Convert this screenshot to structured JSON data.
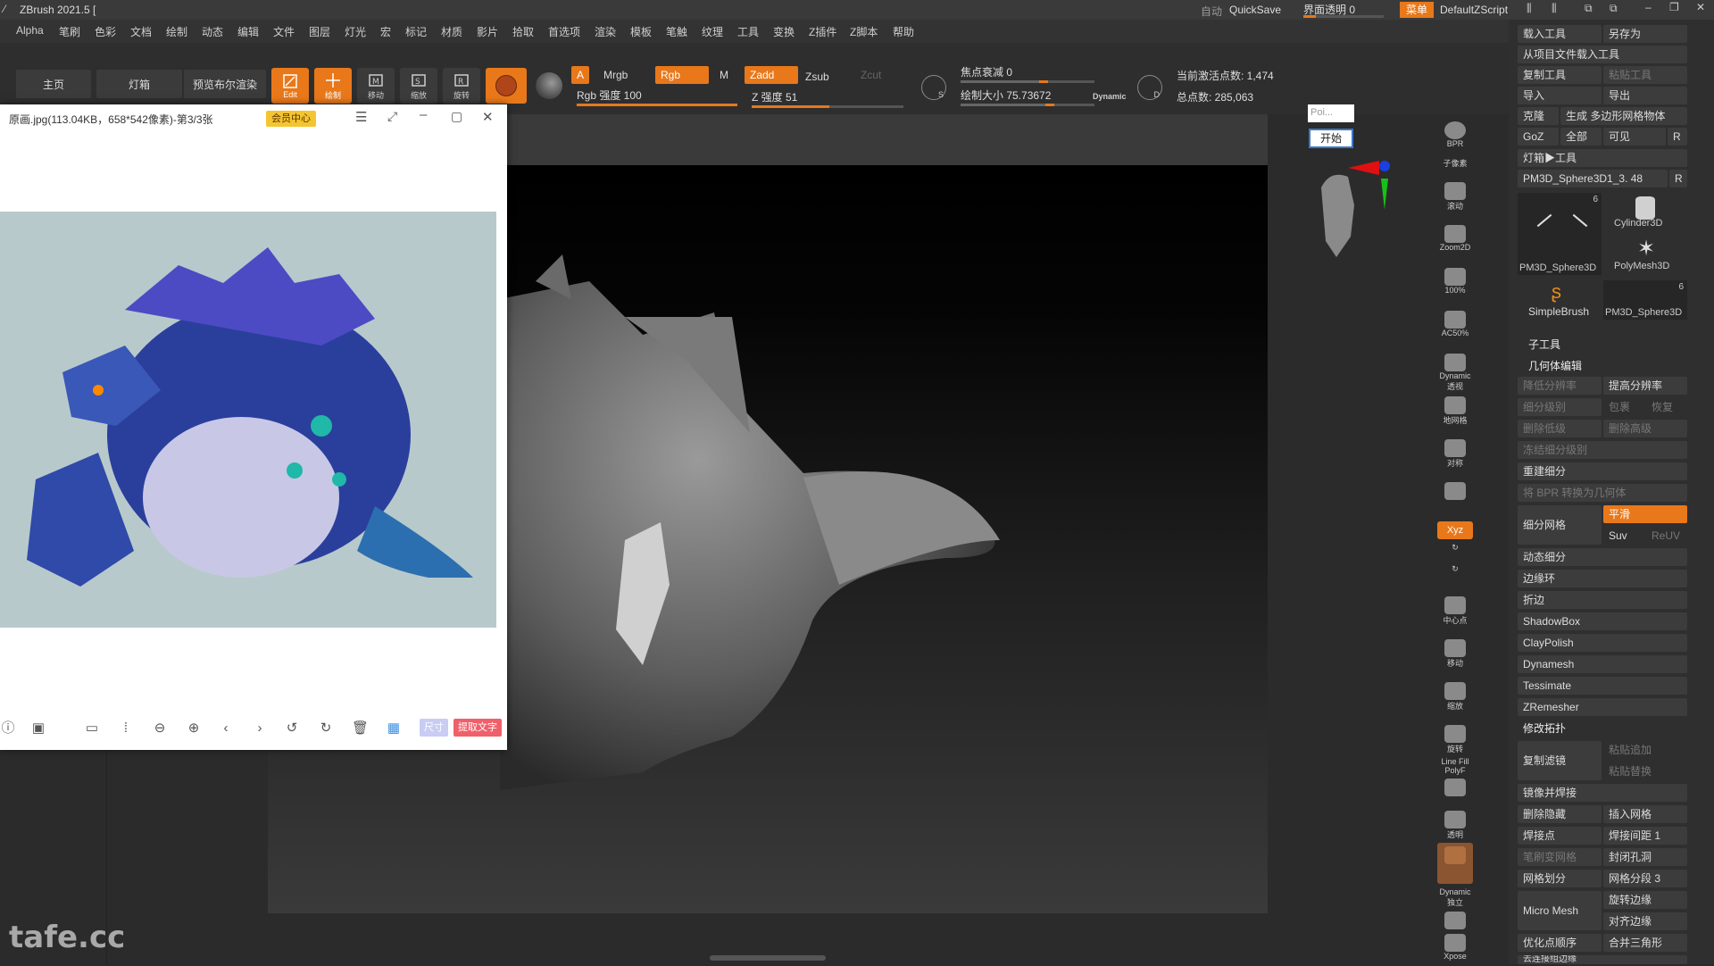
{
  "app": {
    "title": "ZBrush 2021.5 [",
    "auto": "自动",
    "quicksave": "QuickSave",
    "opacity_label": "界面透明 0",
    "menu_btn": "菜单",
    "script": "DefaultZScript"
  },
  "menus": [
    "Alpha",
    "笔刷",
    "色彩",
    "文档",
    "绘制",
    "动态",
    "编辑",
    "文件",
    "图层",
    "灯光",
    "宏",
    "标记",
    "材质",
    "影片",
    "拾取",
    "首选项",
    "渲染",
    "模板",
    "笔触",
    "纹理",
    "工具",
    "变换",
    "Z插件",
    "Z脚本",
    "帮助"
  ],
  "shelf": {
    "tabs": [
      "主页",
      "灯箱",
      "预览布尔渲染"
    ],
    "buttons": [
      "Edit",
      "绘制",
      "移动",
      "缩放",
      "旋转"
    ],
    "a": "A",
    "mrgb": "Mrgb",
    "rgb": "Rgb",
    "m": "M",
    "rgb_intensity": "Rgb 强度 100",
    "zadd": "Zadd",
    "zsub": "Zsub",
    "zcut": "Zcut",
    "z_intensity": "Z 强度 51",
    "focal": "焦点衰减 0",
    "draw_size": "绘制大小 75.73672",
    "dynamic": "Dynamic",
    "active_points": "当前激活点数: 1,474",
    "total_points": "总点数: 285,063",
    "s": "S",
    "d": "D",
    "rgb_level": 1.0,
    "z_level": 0.51
  },
  "popup": {
    "field": "Poi...",
    "start": "开始"
  },
  "viewer": {
    "filename": "原画.jpg(113.04KB，658*542像素)-第3/3张",
    "vip": "会员中心",
    "measure": "尺寸",
    "ocr": "提取文字"
  },
  "rstrip": [
    "BPR",
    "子像素",
    "滚动",
    "Zoom2D",
    "100%",
    "AC50%",
    "Dynamic 透视",
    "地网格",
    "对称",
    "",
    "Xyz",
    "",
    "",
    "中心点",
    "移动",
    "缩放",
    "旋转",
    "Line Fill PolyF",
    "透明",
    "",
    "Dynamic 独立",
    "Xpose"
  ],
  "rpanel": {
    "load_tool": "载入工具",
    "save_as": "另存为",
    "load_from_project": "从项目文件载入工具",
    "copy_tool": "复制工具",
    "paste_tool": "粘贴工具",
    "import": "导入",
    "export": "导出",
    "clone": "克隆",
    "make_polymesh": "生成 多边形网格物体",
    "goz": "GoZ",
    "all": "全部",
    "visible": "可见",
    "r": "R",
    "lightbox_tools": "灯箱▶工具",
    "current_tool": "PM3D_Sphere3D1_3. 48",
    "tools": [
      "PM3D_Sphere3D",
      "Cylinder3D",
      "PolyMesh3D",
      "SimpleBrush",
      "PM3D_Sphere3D"
    ],
    "tool_counts": [
      "6",
      "6"
    ],
    "subtool": "子工具",
    "geometry": "几何体编辑",
    "lower_res": "降低分辨率",
    "higher_res": "提高分辨率",
    "sdiv": "细分级别",
    "cage": "包裹",
    "rstr": "恢复",
    "del_lower": "删除低级",
    "del_higher": "删除高级",
    "freeze": "冻结细分级别",
    "reconstruct": "重建细分",
    "bpr_geo": "将 BPR 转换为几何体",
    "divide": "细分网格",
    "smooth": "平滑",
    "suv": "Suv",
    "reuv": "ReUV",
    "dynamic_sub": "动态细分",
    "edgeloop": "边缘环",
    "crease": "折边",
    "shadowbox": "ShadowBox",
    "claypolish": "ClayPolish",
    "dynamesh": "Dynamesh",
    "tessimate": "Tessimate",
    "zremesher": "ZRemesher",
    "modify_topo": "修改拓扑",
    "copy_filter": "复制滤镜",
    "paste_append": "粘贴追加",
    "paste_replace": "粘贴替换",
    "mirror_weld": "镜像并焊接",
    "del_hidden": "删除隐藏",
    "insert_mesh": "插入网格",
    "weld_points": "焊接点",
    "weld_dist": "焊接间距 1",
    "mesh_from_brush": "笔刷变网格",
    "close_holes": "封闭孔洞",
    "grid_divide": "网格划分",
    "grid_seg": "网格分段 3",
    "micromesh": "Micro Mesh",
    "spin_edge": "旋转边缘",
    "align_edge": "对齐边缘",
    "optimize": "优化点顺序",
    "merge_tris": "合并三角形",
    "unweld": "去连接组边缘"
  },
  "watermark": "tafe.cc"
}
